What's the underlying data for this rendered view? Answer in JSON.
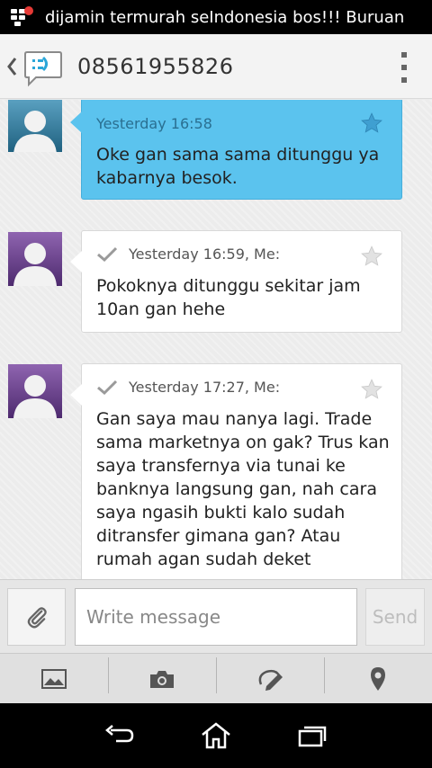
{
  "status_bar": {
    "notification_icon": "bbm-notification-icon",
    "notification_text": "dijamin termurah seIndonesia bos!!! Buruan"
  },
  "action_bar": {
    "up_icon": "chevron-left-icon",
    "app_icon": "messaging-app-icon",
    "title": "08561955826",
    "overflow_icon": "overflow-menu-icon"
  },
  "messages": [
    {
      "direction": "incoming",
      "avatar_color": "#2f6f8e",
      "meta": "Yesterday 16:58",
      "text": "Oke gan sama sama ditunggu ya kabarnya besok.",
      "starred_icon": "star-icon"
    },
    {
      "direction": "outgoing",
      "avatar_color": "#6a3f8c",
      "meta": "Yesterday 16:59, Me:",
      "text": "Pokoknya ditunggu sekitar jam 10an gan hehe",
      "status_icon": "check-icon",
      "starred_icon": "star-icon"
    },
    {
      "direction": "outgoing",
      "avatar_color": "#6a3f8c",
      "meta": "Yesterday 17:27, Me:",
      "text": "Gan saya mau nanya lagi. Trade sama marketnya on gak? Trus kan saya transfernya via tunai ke banknya langsung gan, nah cara saya ngasih bukti kalo sudah ditransfer gimana gan? Atau rumah agan sudah deket",
      "status_icon": "check-icon",
      "starred_icon": "star-icon"
    }
  ],
  "compose": {
    "attach_icon": "paperclip-icon",
    "placeholder": "Write message",
    "send_label": "Send"
  },
  "toolbar": {
    "items": [
      "gallery-icon",
      "camera-icon",
      "sketch-icon",
      "location-icon"
    ]
  },
  "navbar": {
    "items": [
      "back-icon",
      "home-icon",
      "recent-apps-icon"
    ]
  },
  "colors": {
    "incoming_bubble": "#5bc3ee",
    "outgoing_bubble": "#ffffff",
    "status_bar": "#000000"
  }
}
